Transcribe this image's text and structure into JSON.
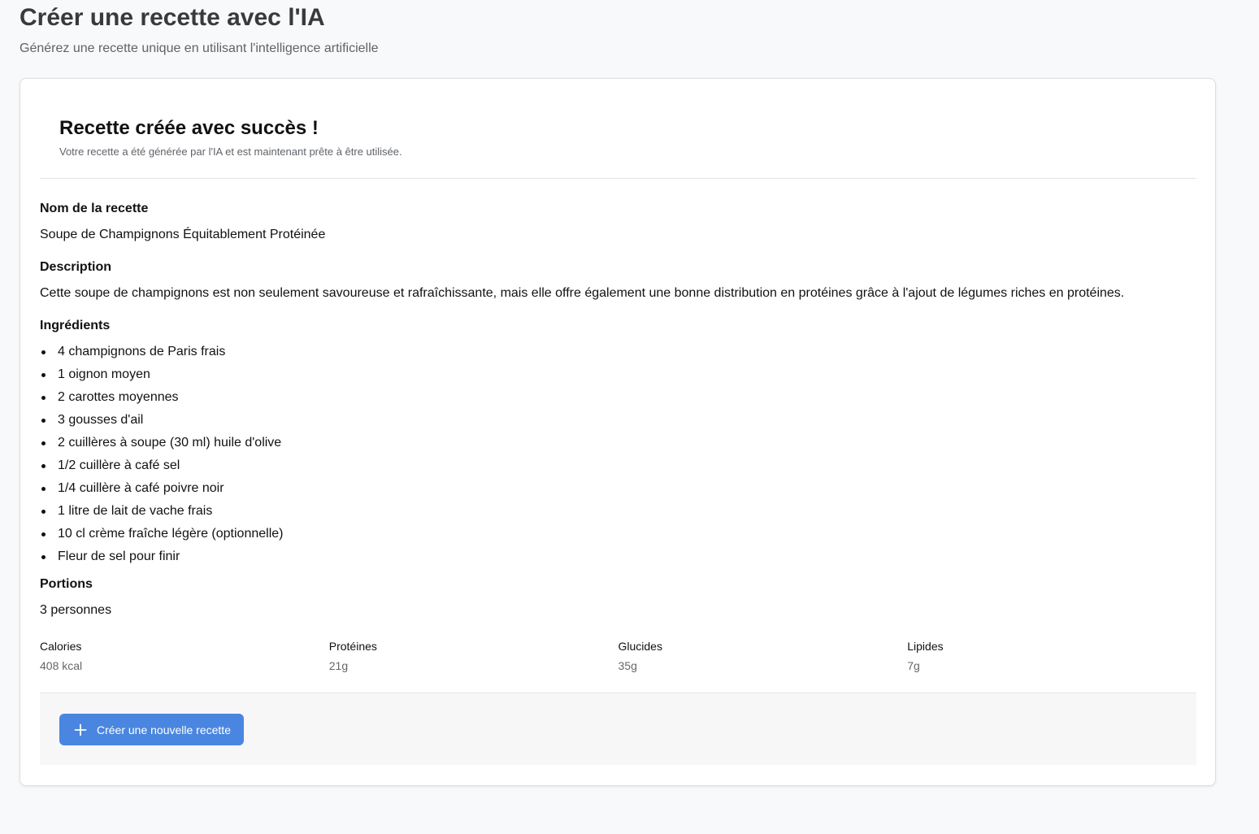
{
  "header": {
    "title": "Créer une recette avec l'IA",
    "subtitle": "Générez une recette unique en utilisant l'intelligence artificielle"
  },
  "result": {
    "title": "Recette créée avec succès !",
    "subtitle": "Votre recette a été générée par l'IA et est maintenant prête à être utilisée."
  },
  "recipe": {
    "name_label": "Nom de la recette",
    "name": "Soupe de Champignons Équitablement Protéinée",
    "description_label": "Description",
    "description": "Cette soupe de champignons est non seulement savoureuse et rafraîchissante, mais elle offre également une bonne distribution en protéines grâce à l'ajout de légumes riches en protéines.",
    "ingredients_label": "Ingrédients",
    "ingredients": [
      "4 champignons de Paris frais",
      "1 oignon moyen",
      "2 carottes moyennes",
      "3 gousses d'ail",
      "2 cuillères à soupe (30 ml) huile d'olive",
      "1/2 cuillère à café sel",
      "1/4 cuillère à café poivre noir",
      "1 litre de lait de vache frais",
      "10 cl crème fraîche légère (optionnelle)",
      "Fleur de sel pour finir"
    ],
    "portions_label": "Portions",
    "portions": "3 personnes"
  },
  "nutrition": [
    {
      "label": "Calories",
      "value": "408 kcal"
    },
    {
      "label": "Protéines",
      "value": "21g"
    },
    {
      "label": "Glucides",
      "value": "35g"
    },
    {
      "label": "Lipides",
      "value": "7g"
    }
  ],
  "actions": {
    "new_recipe_label": "Créer une nouvelle recette",
    "new_recipe_icon": "plus-icon"
  },
  "colors": {
    "primary": "#4a86e0",
    "background": "#f8f9fa"
  }
}
